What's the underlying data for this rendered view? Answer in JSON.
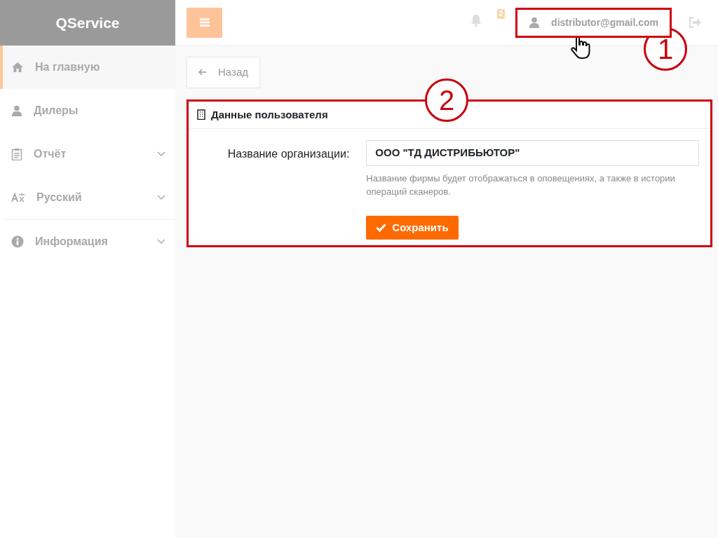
{
  "brand": "QService",
  "sidebar": {
    "items": [
      {
        "label": "На главную",
        "kind": "link",
        "selected": true
      },
      {
        "label": "Дилеры",
        "kind": "link",
        "selected": false
      },
      {
        "label": "Отчёт",
        "kind": "dropdown",
        "selected": false
      },
      {
        "label": "Русский",
        "kind": "dropdown",
        "selected": false
      },
      {
        "label": "Информация",
        "kind": "dropdown",
        "selected": false
      }
    ]
  },
  "topbar": {
    "notifications_count": "2",
    "user_email": "distributor@gmail.com"
  },
  "back_button": "Назад",
  "card": {
    "title": "Данные пользователя",
    "field_label": "Название организации:",
    "field_value": "ООО \"ТД ДИСТРИБЬЮТОР\"",
    "help_text": "Название фирмы будет отображаться в оповещениях, а также в истории операций сканеров.",
    "save_button": "Сохранить"
  },
  "callouts": [
    "1",
    "2"
  ]
}
